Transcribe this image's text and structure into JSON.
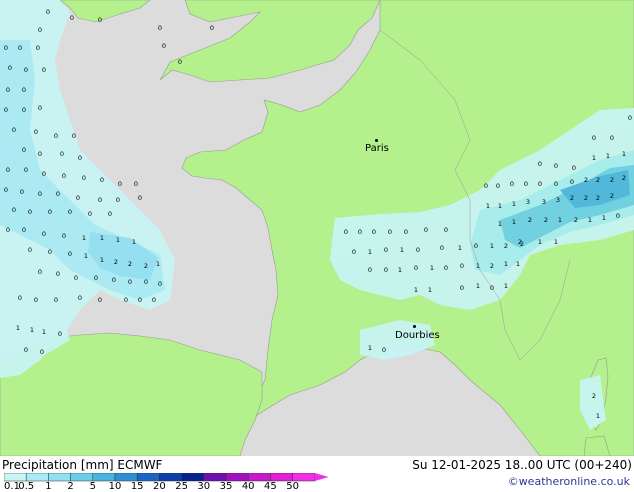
{
  "map": {
    "cities": [
      {
        "name": "Paris",
        "id": "paris"
      },
      {
        "name": "Dourbies",
        "id": "dourbies"
      }
    ],
    "precip_labels": [
      {
        "v": "0",
        "id": "a"
      },
      {
        "v": "1",
        "id": "b"
      },
      {
        "v": "2",
        "id": "c"
      },
      {
        "v": "3",
        "id": "d"
      },
      {
        "v": "5",
        "id": "e"
      }
    ]
  },
  "footer": {
    "title_left": "Precipitation [mm]  ECMWF",
    "title_right": "Su 12-01-2025 18..00 UTC (00+240)",
    "credit": "©weatheronline.co.uk"
  },
  "legend": {
    "ticks": [
      "0.1",
      "0.5",
      "1",
      "2",
      "5",
      "10",
      "15",
      "20",
      "25",
      "30",
      "35",
      "40",
      "45",
      "50"
    ],
    "colors": [
      "#c8f5f5",
      "#a8ecf5",
      "#8ee0f2",
      "#6ccfe8",
      "#4ab4e0",
      "#2e8fd4",
      "#1a64c2",
      "#0c3fa8",
      "#08228c",
      "#7010b0",
      "#a010c0",
      "#c818cc",
      "#e020d8",
      "#f030e8"
    ]
  }
}
